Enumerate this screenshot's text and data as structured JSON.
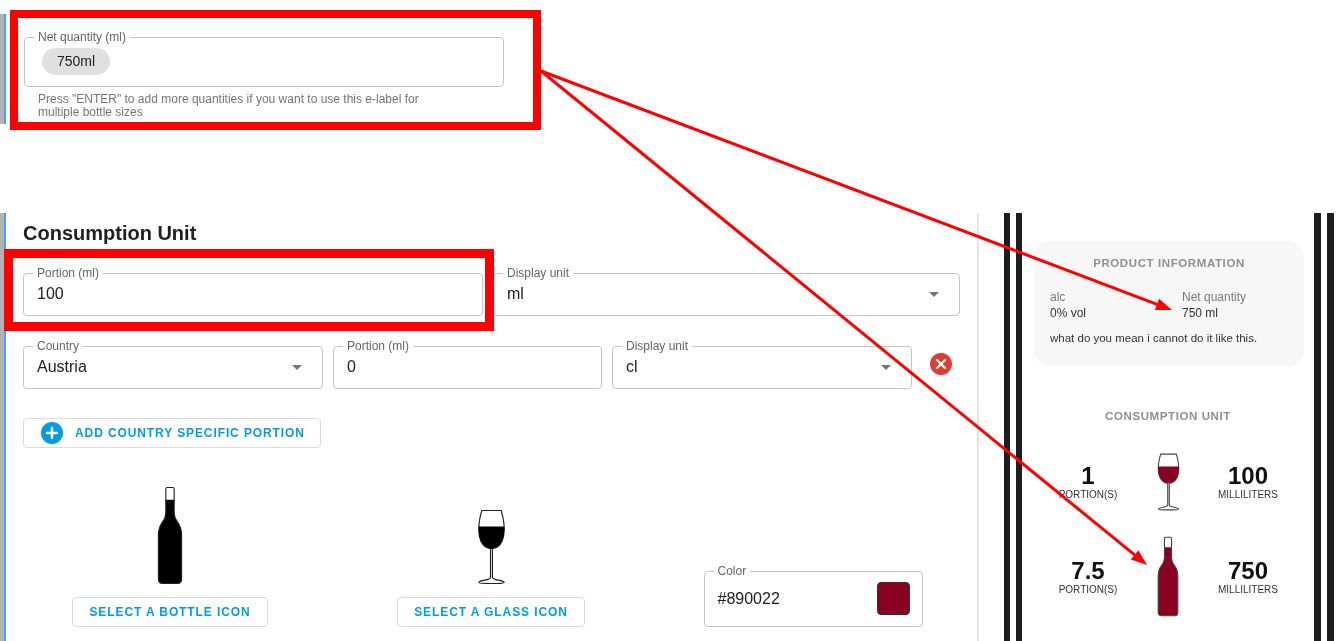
{
  "net_quantity": {
    "label": "Net quantity (ml)",
    "chips": [
      "750ml"
    ],
    "helper_text": "Press \"ENTER\" to add more quantities if you want to use this e-label for multiple bottle sizes"
  },
  "consumption_unit": {
    "title": "Consumption Unit",
    "default_row": [
      {
        "kind": "input",
        "label": "Portion (ml)",
        "value": "100"
      },
      {
        "kind": "select",
        "label": "Display unit",
        "value": "ml"
      }
    ],
    "country_rows": [
      {
        "fields": [
          {
            "kind": "select",
            "label": "Country",
            "value": "Austria"
          },
          {
            "kind": "input",
            "label": "Portion (ml)",
            "value": "0"
          },
          {
            "kind": "select",
            "label": "Display unit",
            "value": "cl"
          }
        ]
      }
    ],
    "add_button": "ADD COUNTRY SPECIFIC PORTION",
    "icon_pickers": [
      {
        "kind": "bottle",
        "button": "SELECT A BOTTLE ICON"
      },
      {
        "kind": "glass",
        "button": "SELECT A GLASS ICON"
      }
    ],
    "color_field": {
      "label": "Color",
      "value": "#890022",
      "color": "#890022"
    }
  },
  "preview": {
    "product_information": {
      "title": "PRODUCT INFORMATION",
      "facts": [
        {
          "label": "alc",
          "value": "0% vol"
        },
        {
          "label": "Net quantity",
          "value": "750 ml"
        }
      ],
      "note": "what do you mean i cannot do it like this."
    },
    "consumption_unit": {
      "title": "CONSUMPTION UNIT",
      "rows": [
        {
          "kind": "glass",
          "portions": "1",
          "portions_unit": "PORTION(S)",
          "amount": "100",
          "amount_unit": "MILLILITERS"
        },
        {
          "kind": "bottle",
          "portions": "7.5",
          "portions_unit": "PORTION(S)",
          "amount": "750",
          "amount_unit": "MILLILITERS"
        }
      ]
    }
  }
}
